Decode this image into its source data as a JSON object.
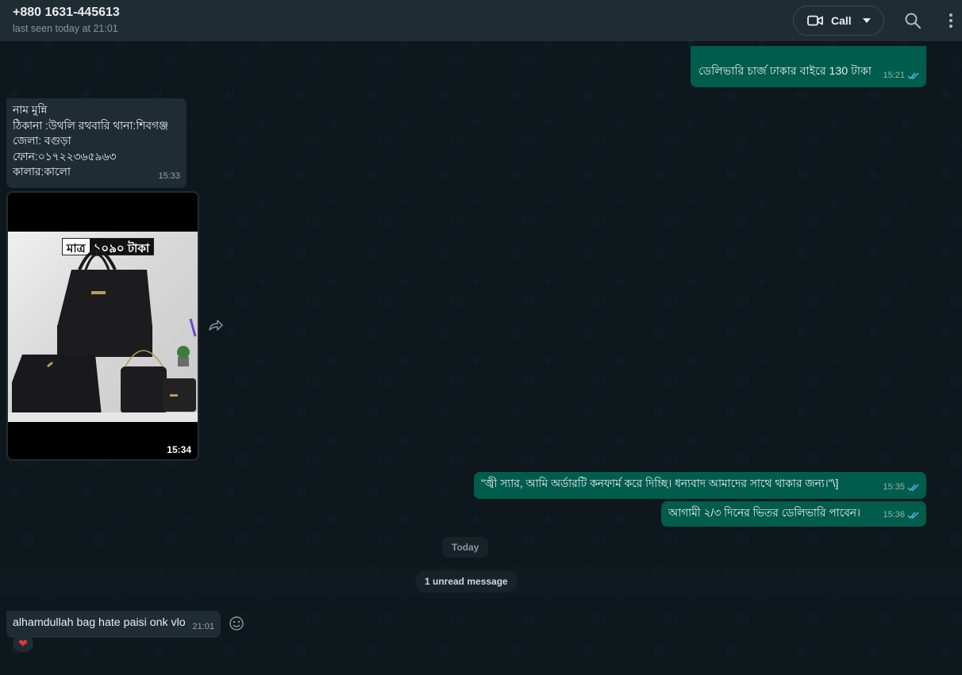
{
  "header": {
    "contact_name": "+880 1631-445613",
    "status": "last seen today at 21:01",
    "call_label": "Call"
  },
  "messages": {
    "m1": {
      "text": "ডেলিভারি চার্জ ঢাকার বাইরে 130 টাকা",
      "time": "15:21"
    },
    "m2": {
      "text": "নাম মুন্নি\nঠিকানা :উথলি রথবারি থানা:শিবগঞ্জ\nজেলা: বগুড়া\nফোন:০১৭২২৩৬৫৯৬৩\nকালার:কালো",
      "time": "15:33"
    },
    "m3": {
      "price_label_1": "মাত্র",
      "price_label_2": "১০৯০ টাকা",
      "time": "15:34"
    },
    "m4": {
      "text": "\"জ্বী স্যার, আমি অর্ডারটি কনফার্ম করে দিচ্ছি। ধন্যবাদ আমাদের সাথে থাকার জন্য।\"\\]",
      "time": "15:35"
    },
    "m5": {
      "text": "আগামী ২/৩ দিনের ভিতর ডেলিভারি পাবেন।",
      "time": "15:36"
    },
    "m6": {
      "text": "alhamdullah bag hate paisi onk vlo",
      "time": "21:01",
      "reaction": "❤"
    }
  },
  "date_divider": "Today",
  "unread_label": "1 unread message",
  "colors": {
    "header_bg": "#202c33",
    "outgoing_bubble": "#005c4b",
    "incoming_bubble": "#202c33",
    "tick_blue": "#53bdeb"
  },
  "icons": [
    "video-call-icon",
    "chevron-down-icon",
    "search-icon",
    "menu-icon",
    "forward-icon",
    "emoji-icon",
    "double-check-icon"
  ]
}
